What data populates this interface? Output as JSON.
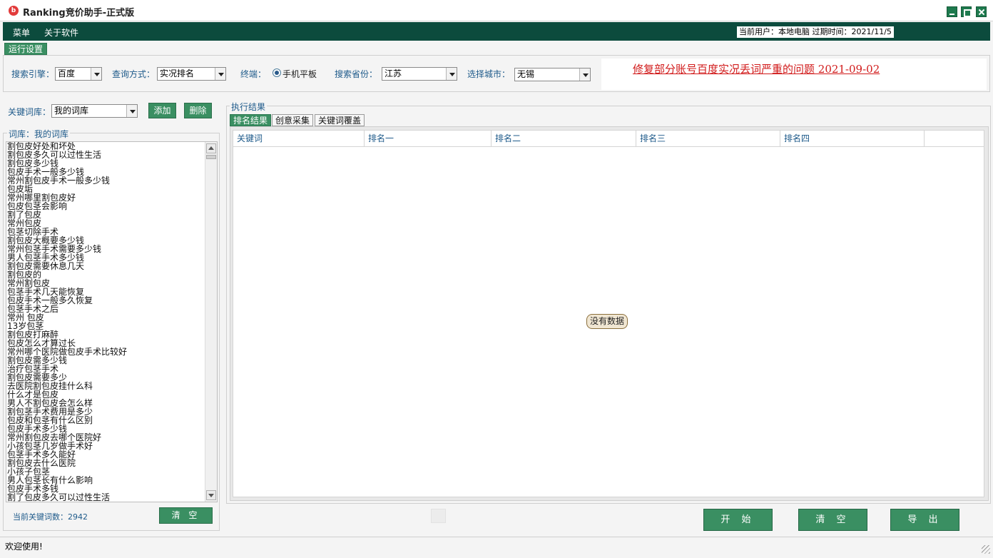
{
  "window": {
    "title": "Ranking竞价助手-正式版",
    "icon_letter": "b"
  },
  "menubar": {
    "items": [
      "菜单",
      "关于软件"
    ],
    "user_label": "当前用户：",
    "user_name": "本地电脑",
    "expire_label": "过期时间：",
    "expire_date": "2021/11/5"
  },
  "settings": {
    "tab_label": "运行设置",
    "engine_label": "搜索引擎：",
    "engine_value": "百度",
    "query_label": "查询方式：",
    "query_value": "实况排名",
    "terminal_label": "终端：",
    "terminal_value": "手机平板",
    "province_label": "搜索省份：",
    "province_value": "江苏",
    "city_label": "选择城市：",
    "city_value": "无锡",
    "notice": "修复部分账号百度实况丢词严重的问题  2021-09-02"
  },
  "library": {
    "label": "关键词库：",
    "value": "我的词库",
    "add_button": "添加",
    "delete_button": "删除",
    "group_title": "词库：我的词库",
    "keywords": [
      "割包皮好处和坏处",
      "割包皮多久可以过性生活",
      "割包皮多少钱",
      "包皮手术一般多少钱",
      "常州割包皮手术一般多少钱",
      "包皮垢",
      "常州哪里割包皮好",
      "包皮包茎会影响",
      "割了包皮",
      "常州包皮",
      "包茎切除手术",
      "割包皮大概要多少钱",
      "常州包茎手术需要多少钱",
      "男人包茎手术多少钱",
      "割包皮需要休息几天",
      "割包皮的",
      "常州割包皮",
      "包茎手术几天能恢复",
      "包皮手术一般多久恢复",
      "包茎手术之后",
      "常州 包皮",
      "13岁包茎",
      "割包皮打麻醉",
      "包皮怎么才算过长",
      "常州哪个医院做包皮手术比较好",
      "割包皮需多少钱",
      "治疗包茎手术",
      "割包皮需要多少",
      "去医院割包皮挂什么科",
      "什么才是包皮",
      "男人不割包皮会怎么样",
      "割包茎手术费用是多少",
      "包皮和包茎有什么区别",
      "包皮手术多少钱",
      "常州割包皮去哪个医院好",
      "小孩包茎几岁做手术好",
      "包茎手术多久能好",
      "割包皮去什么医院",
      "小孩子包茎",
      "男人包茎长有什么影响",
      "包皮手术多钱",
      "割了包皮多久可以过性生活"
    ],
    "count_label": "当前关键词数：",
    "count_value": "2942",
    "clear_button": "清 空"
  },
  "results": {
    "group_title": "执行结果",
    "tabs": [
      "排名结果",
      "创意采集",
      "关键词覆盖"
    ],
    "columns": [
      "关键词",
      "排名一",
      "排名二",
      "排名三",
      "排名四"
    ],
    "empty_text": "没有数据"
  },
  "actions": {
    "start": "开 始",
    "clear": "清 空",
    "export": "导 出"
  },
  "status": {
    "text": "欢迎使用!"
  }
}
